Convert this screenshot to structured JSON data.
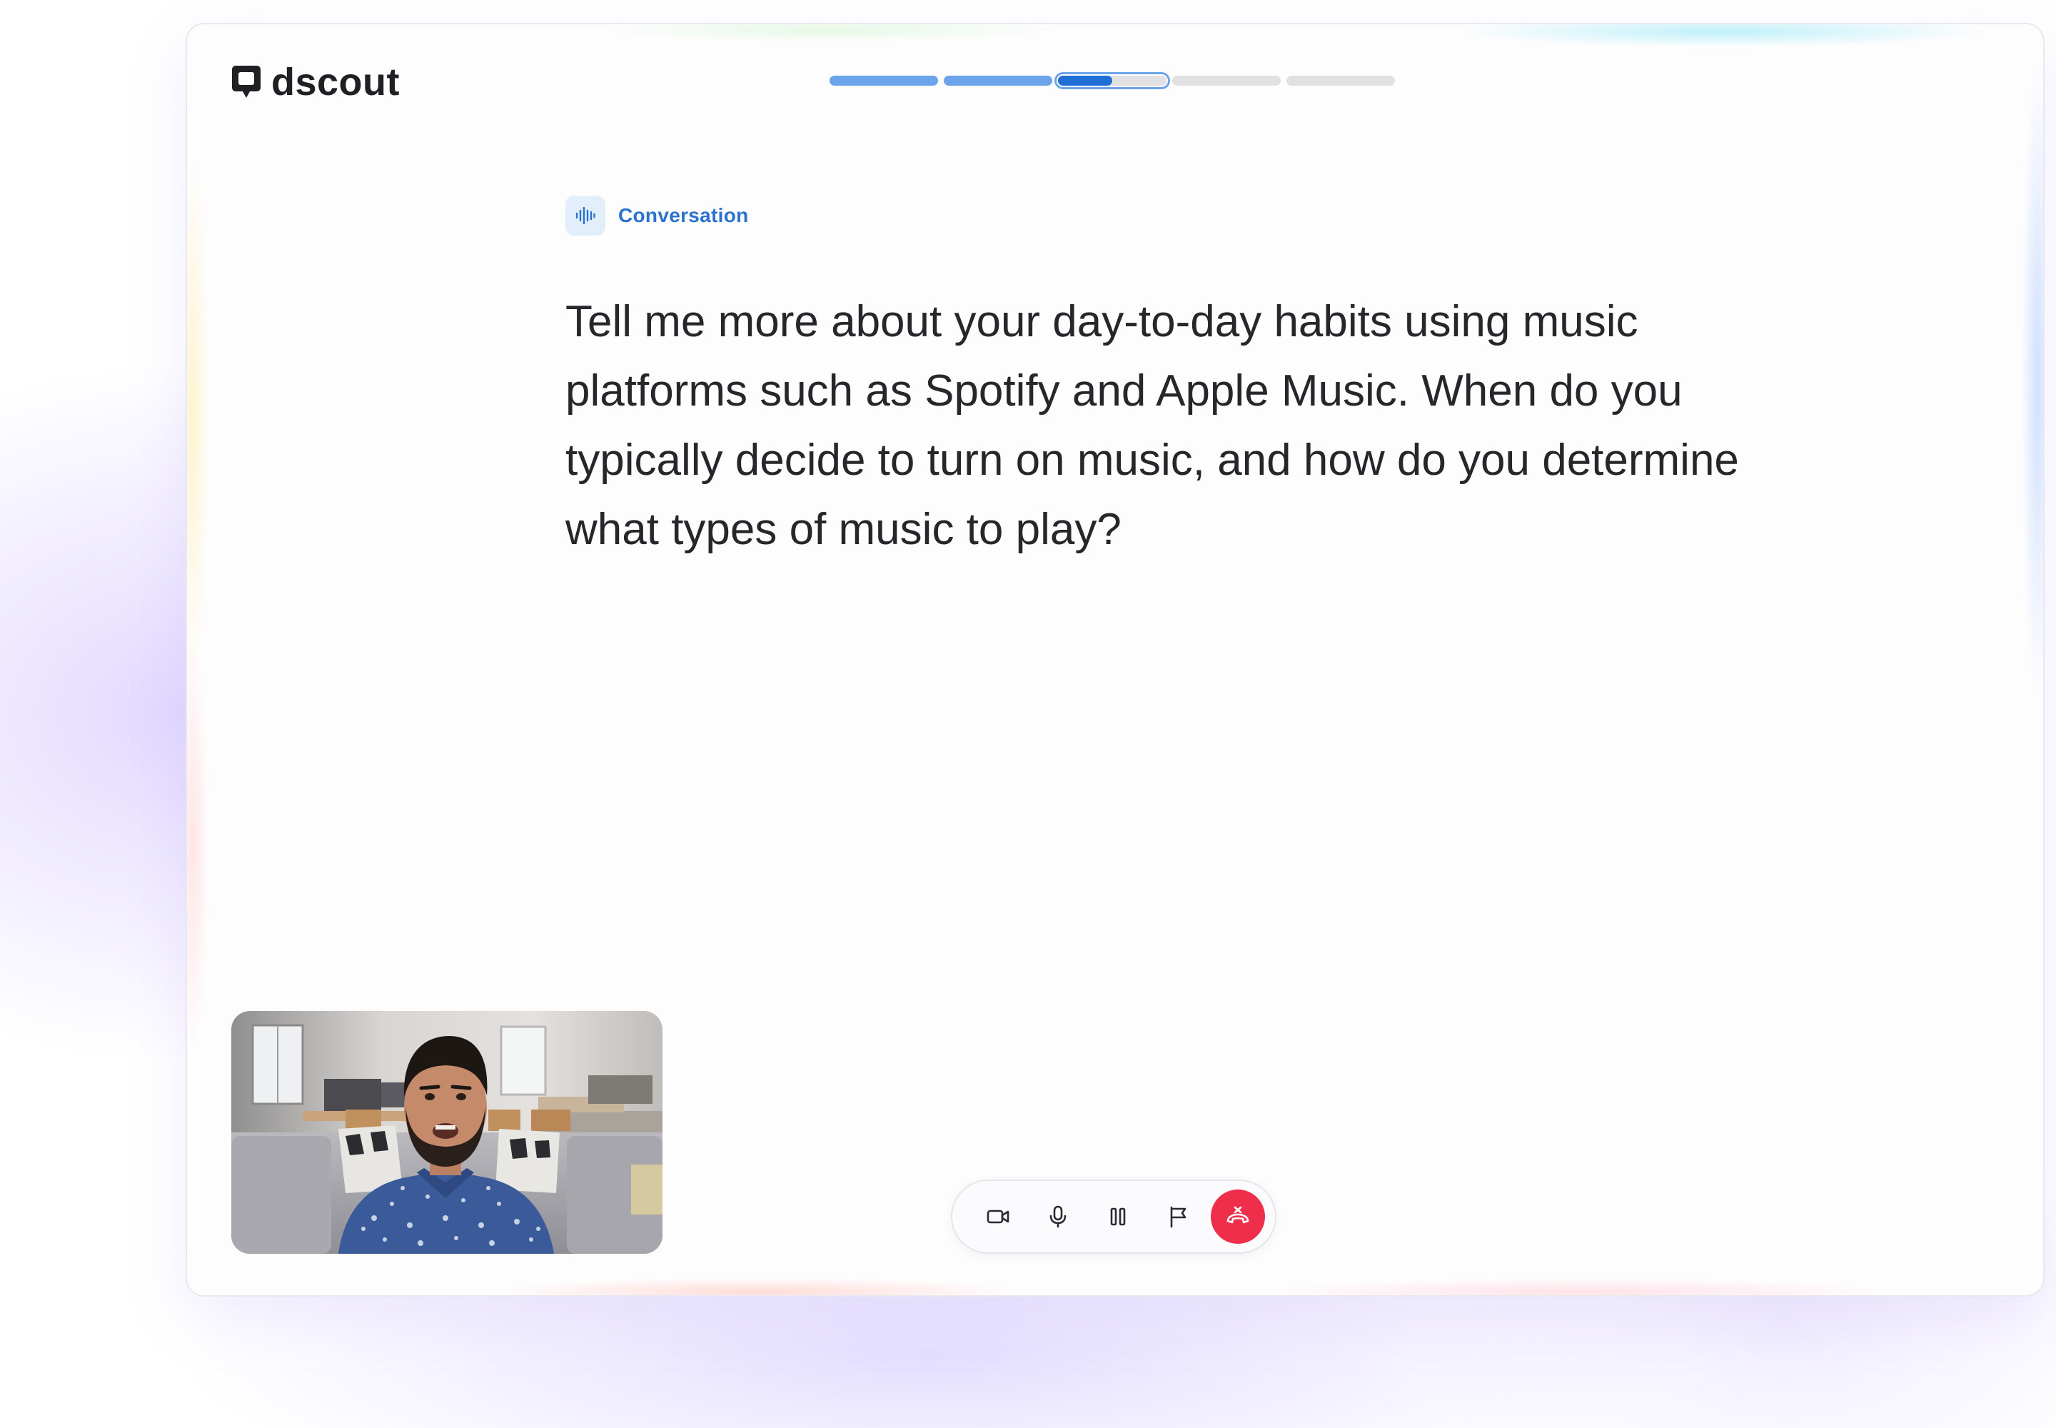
{
  "brand": {
    "name": "dscout"
  },
  "progress": {
    "total_steps": 5,
    "completed_steps": 2,
    "current_step": 3,
    "current_step_fraction": 0.5
  },
  "prompt": {
    "type_label": "Conversation",
    "type_icon": "audio-waveform-icon",
    "question": "Tell me more about your day-to-day habits using music platforms such as Spotify and Apple Music. When do you typically decide to turn on music, and how do you determine what types of music to play?"
  },
  "video": {
    "participant_icon": "participant-video-feed"
  },
  "controls": {
    "buttons": [
      {
        "id": "camera",
        "icon": "video-camera-icon"
      },
      {
        "id": "microphone",
        "icon": "microphone-icon"
      },
      {
        "id": "pause",
        "icon": "pause-icon"
      },
      {
        "id": "flag",
        "icon": "flag-icon"
      },
      {
        "id": "end-call",
        "icon": "hang-up-phone-icon"
      }
    ]
  },
  "colors": {
    "accent_blue": "#1f6fd6",
    "progress_done": "#6ba4ea",
    "progress_empty": "#e1e1e4",
    "tag_text": "#2a72d1",
    "end_call_red": "#ee2e4b",
    "text_primary": "#26262b"
  }
}
